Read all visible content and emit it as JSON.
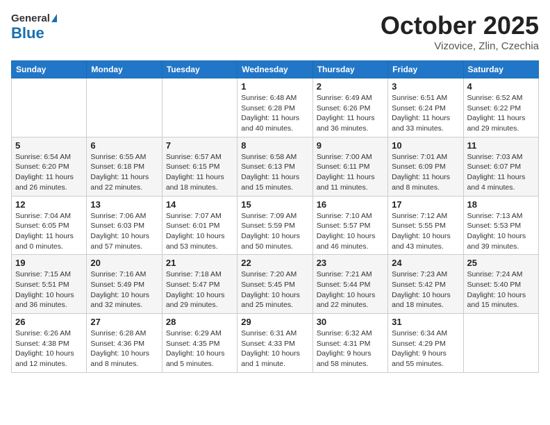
{
  "logo": {
    "general": "General",
    "blue": "Blue"
  },
  "title": "October 2025",
  "location": "Vizovice, Zlin, Czechia",
  "days_of_week": [
    "Sunday",
    "Monday",
    "Tuesday",
    "Wednesday",
    "Thursday",
    "Friday",
    "Saturday"
  ],
  "weeks": [
    [
      {
        "num": "",
        "info": ""
      },
      {
        "num": "",
        "info": ""
      },
      {
        "num": "",
        "info": ""
      },
      {
        "num": "1",
        "info": "Sunrise: 6:48 AM\nSunset: 6:28 PM\nDaylight: 11 hours and 40 minutes."
      },
      {
        "num": "2",
        "info": "Sunrise: 6:49 AM\nSunset: 6:26 PM\nDaylight: 11 hours and 36 minutes."
      },
      {
        "num": "3",
        "info": "Sunrise: 6:51 AM\nSunset: 6:24 PM\nDaylight: 11 hours and 33 minutes."
      },
      {
        "num": "4",
        "info": "Sunrise: 6:52 AM\nSunset: 6:22 PM\nDaylight: 11 hours and 29 minutes."
      }
    ],
    [
      {
        "num": "5",
        "info": "Sunrise: 6:54 AM\nSunset: 6:20 PM\nDaylight: 11 hours and 26 minutes."
      },
      {
        "num": "6",
        "info": "Sunrise: 6:55 AM\nSunset: 6:18 PM\nDaylight: 11 hours and 22 minutes."
      },
      {
        "num": "7",
        "info": "Sunrise: 6:57 AM\nSunset: 6:15 PM\nDaylight: 11 hours and 18 minutes."
      },
      {
        "num": "8",
        "info": "Sunrise: 6:58 AM\nSunset: 6:13 PM\nDaylight: 11 hours and 15 minutes."
      },
      {
        "num": "9",
        "info": "Sunrise: 7:00 AM\nSunset: 6:11 PM\nDaylight: 11 hours and 11 minutes."
      },
      {
        "num": "10",
        "info": "Sunrise: 7:01 AM\nSunset: 6:09 PM\nDaylight: 11 hours and 8 minutes."
      },
      {
        "num": "11",
        "info": "Sunrise: 7:03 AM\nSunset: 6:07 PM\nDaylight: 11 hours and 4 minutes."
      }
    ],
    [
      {
        "num": "12",
        "info": "Sunrise: 7:04 AM\nSunset: 6:05 PM\nDaylight: 11 hours and 0 minutes."
      },
      {
        "num": "13",
        "info": "Sunrise: 7:06 AM\nSunset: 6:03 PM\nDaylight: 10 hours and 57 minutes."
      },
      {
        "num": "14",
        "info": "Sunrise: 7:07 AM\nSunset: 6:01 PM\nDaylight: 10 hours and 53 minutes."
      },
      {
        "num": "15",
        "info": "Sunrise: 7:09 AM\nSunset: 5:59 PM\nDaylight: 10 hours and 50 minutes."
      },
      {
        "num": "16",
        "info": "Sunrise: 7:10 AM\nSunset: 5:57 PM\nDaylight: 10 hours and 46 minutes."
      },
      {
        "num": "17",
        "info": "Sunrise: 7:12 AM\nSunset: 5:55 PM\nDaylight: 10 hours and 43 minutes."
      },
      {
        "num": "18",
        "info": "Sunrise: 7:13 AM\nSunset: 5:53 PM\nDaylight: 10 hours and 39 minutes."
      }
    ],
    [
      {
        "num": "19",
        "info": "Sunrise: 7:15 AM\nSunset: 5:51 PM\nDaylight: 10 hours and 36 minutes."
      },
      {
        "num": "20",
        "info": "Sunrise: 7:16 AM\nSunset: 5:49 PM\nDaylight: 10 hours and 32 minutes."
      },
      {
        "num": "21",
        "info": "Sunrise: 7:18 AM\nSunset: 5:47 PM\nDaylight: 10 hours and 29 minutes."
      },
      {
        "num": "22",
        "info": "Sunrise: 7:20 AM\nSunset: 5:45 PM\nDaylight: 10 hours and 25 minutes."
      },
      {
        "num": "23",
        "info": "Sunrise: 7:21 AM\nSunset: 5:44 PM\nDaylight: 10 hours and 22 minutes."
      },
      {
        "num": "24",
        "info": "Sunrise: 7:23 AM\nSunset: 5:42 PM\nDaylight: 10 hours and 18 minutes."
      },
      {
        "num": "25",
        "info": "Sunrise: 7:24 AM\nSunset: 5:40 PM\nDaylight: 10 hours and 15 minutes."
      }
    ],
    [
      {
        "num": "26",
        "info": "Sunrise: 6:26 AM\nSunset: 4:38 PM\nDaylight: 10 hours and 12 minutes."
      },
      {
        "num": "27",
        "info": "Sunrise: 6:28 AM\nSunset: 4:36 PM\nDaylight: 10 hours and 8 minutes."
      },
      {
        "num": "28",
        "info": "Sunrise: 6:29 AM\nSunset: 4:35 PM\nDaylight: 10 hours and 5 minutes."
      },
      {
        "num": "29",
        "info": "Sunrise: 6:31 AM\nSunset: 4:33 PM\nDaylight: 10 hours and 1 minute."
      },
      {
        "num": "30",
        "info": "Sunrise: 6:32 AM\nSunset: 4:31 PM\nDaylight: 9 hours and 58 minutes."
      },
      {
        "num": "31",
        "info": "Sunrise: 6:34 AM\nSunset: 4:29 PM\nDaylight: 9 hours and 55 minutes."
      },
      {
        "num": "",
        "info": ""
      }
    ]
  ]
}
